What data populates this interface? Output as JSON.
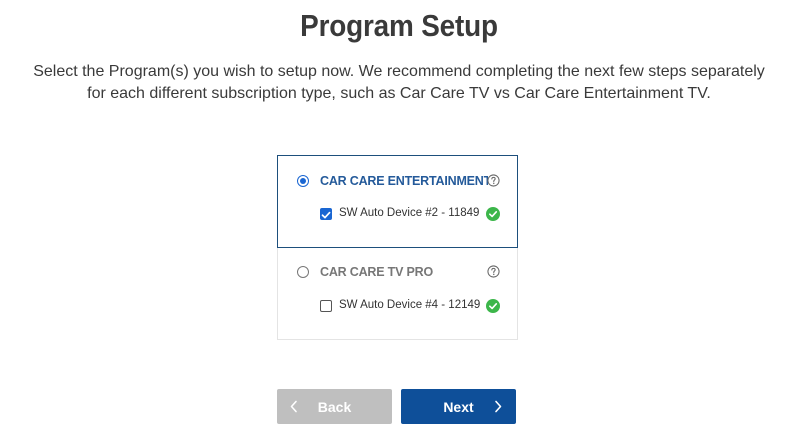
{
  "page": {
    "title": "Program Setup",
    "description_line1": "Select the Program(s) you wish to setup now. We recommend completing the next few steps separately",
    "description_line2": "for each different subscription type, such as Car Care TV vs Car Care Entertainment TV."
  },
  "programs": [
    {
      "name": "CAR CARE ENTERTAINMENT TV",
      "selected": true,
      "help_icon": "question-circle-icon",
      "devices": [
        {
          "label": "SW Auto Device #2 - 11849",
          "checked": true,
          "status_icon": "check-circle-icon",
          "status_color": "#3cb64a"
        }
      ]
    },
    {
      "name": "CAR CARE TV PRO",
      "selected": false,
      "help_icon": "question-circle-icon",
      "devices": [
        {
          "label": "SW Auto Device #4 - 12149",
          "checked": false,
          "status_icon": "check-circle-icon",
          "status_color": "#3cb64a"
        }
      ]
    }
  ],
  "buttons": {
    "back": {
      "label": "Back",
      "icon": "chevron-left-icon",
      "color": "#bfbfbf"
    },
    "next": {
      "label": "Next",
      "icon": "chevron-right-icon",
      "color": "#0e4f99"
    }
  },
  "colors": {
    "accent": "#1a66d2",
    "selected_text": "#245a9a",
    "success": "#3cb64a"
  }
}
